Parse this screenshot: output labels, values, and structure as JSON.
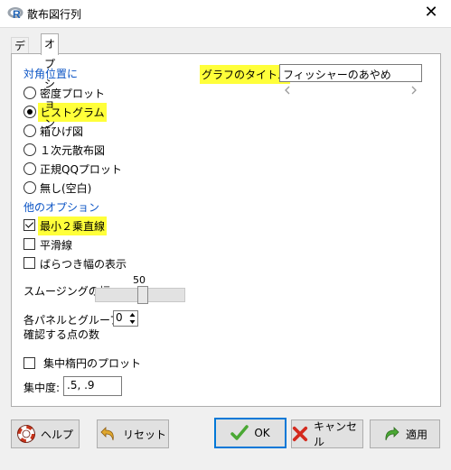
{
  "window": {
    "title": "散布図行列",
    "close_glyph": "✕"
  },
  "tabs": [
    {
      "label": "データ"
    },
    {
      "label": "オプション"
    }
  ],
  "diagonal": {
    "heading": "対角位置に",
    "options": [
      "密度プロット",
      "ヒストグラム",
      "箱ひげ図",
      "１次元散布図",
      "正規QQプロット",
      "無し(空白)"
    ],
    "selected": "ヒストグラム"
  },
  "graph_title": {
    "label": "グラフのタイトル",
    "value": "フィッシャーのあやめ"
  },
  "other": {
    "heading": "他のオプション",
    "least_squares": {
      "label": "最小２乗直線",
      "checked": true
    },
    "smooth": {
      "label": "平滑線",
      "checked": false
    },
    "spread": {
      "label": "ばらつき幅の表示",
      "checked": false
    }
  },
  "smoothing": {
    "label": "スムージングの幅",
    "value": "50"
  },
  "identify": {
    "label_line1": "各パネルとグループで",
    "label_line2": "確認する点の数",
    "value": "0"
  },
  "ellipse": {
    "label": "集中楕円のプロット",
    "checked": false
  },
  "concentration": {
    "label": "集中度:",
    "value": ".5, .9"
  },
  "buttons": {
    "help": "ヘルプ",
    "reset": "リセット",
    "ok": "OK",
    "cancel": "キャンセル",
    "apply": "適用"
  },
  "colors": {
    "heading_blue": "#0b54c5",
    "highlight": "#ffff3a",
    "default_border": "#0078d7"
  }
}
